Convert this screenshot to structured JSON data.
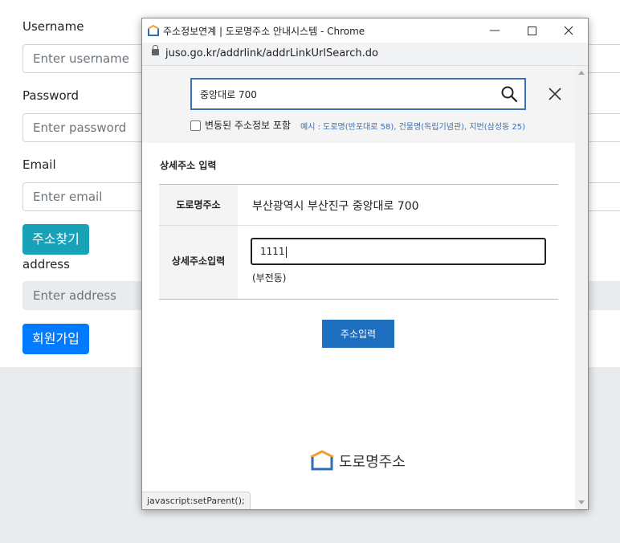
{
  "form": {
    "username_label": "Username",
    "username_placeholder": "Enter username",
    "password_label": "Password",
    "password_placeholder": "Enter password",
    "email_label": "Email",
    "email_placeholder": "Enter email",
    "find_address_button": "주소찾기",
    "address_label": "address",
    "address_placeholder": "Enter address",
    "signup_button": "회원가입"
  },
  "popup": {
    "window_title": "주소정보연계 | 도로명주소 안내시스템 - Chrome",
    "url": "juso.go.kr/addrlink/addrLinkUrlSearch.do",
    "search_value": "중앙대로 700",
    "checkbox_label": "변동된 주소정보 포함",
    "example_text": "예시 : 도로명(반포대로 58), 건물명(독립기념관), 지번(삼성동 25)",
    "section_title": "상세주소 입력",
    "road_address_label": "도로명주소",
    "road_address_value": "부산광역시 부산진구 중앙대로 700",
    "detail_label": "상세주소입력",
    "detail_value": "1111",
    "detail_note": "(부전동)",
    "submit_button": "주소입력",
    "logo_text": "도로명주소",
    "status_text": "javascript:setParent();"
  },
  "colors": {
    "teal_button": "#17a2b8",
    "blue_button": "#007bff",
    "submit_button": "#1e6fbf",
    "search_border": "#3c6fb4"
  }
}
